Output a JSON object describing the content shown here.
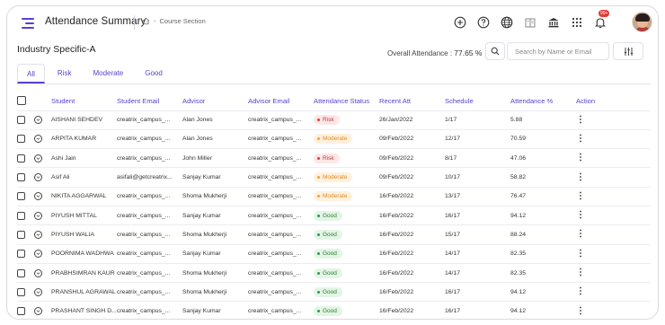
{
  "header": {
    "title": "Attendance Summary",
    "breadcrumb": "Course Section",
    "notification_count": "99+",
    "icons": [
      "add-circle-icon",
      "help-icon",
      "globe-icon",
      "book-icon",
      "institution-icon",
      "grid-icon",
      "bell-icon"
    ]
  },
  "section": {
    "title": "Industry Specific-A",
    "overall_label": "Overall Attendance : ",
    "overall_value": "77.65 %"
  },
  "search": {
    "placeholder": "Search by Name or Email"
  },
  "tabs": [
    {
      "label": "All"
    },
    {
      "label": "Risk"
    },
    {
      "label": "Moderate"
    },
    {
      "label": "Good"
    }
  ],
  "table": {
    "headers": [
      "Student",
      "Student Email",
      "Advisor",
      "Advisor Email",
      "Attendance Status",
      "Recent Att",
      "Schedule",
      "Attendance %",
      "Action"
    ],
    "rows": [
      {
        "student": "AISHANI SEHDEV",
        "email": "creatrix_campus_...",
        "advisor": "Alan Jones",
        "advisor_email": "creatrix_campus_...",
        "status": "Risk",
        "recent": "26/Jan/2022",
        "schedule": "1/17",
        "percent": "5.88"
      },
      {
        "student": "ARPITA KUMAR",
        "email": "creatrix_campus_...",
        "advisor": "Alan Jones",
        "advisor_email": "creatrix_campus_...",
        "status": "Moderate",
        "recent": "09/Feb/2022",
        "schedule": "12/17",
        "percent": "70.59"
      },
      {
        "student": "Ashi Jain",
        "email": "creatrix_campus_...",
        "advisor": "John Miller",
        "advisor_email": "creatrix_campus_...",
        "status": "Risk",
        "recent": "09/Feb/2022",
        "schedule": "8/17",
        "percent": "47.06"
      },
      {
        "student": "Asif Ali",
        "email": "asifali@getcreatrix...",
        "advisor": "Sanjay Kumar",
        "advisor_email": "creatrix_campus_...",
        "status": "Moderate",
        "recent": "09/Feb/2022",
        "schedule": "10/17",
        "percent": "58.82"
      },
      {
        "student": "NIKITA AGGARWAL",
        "email": "creatrix_campus_...",
        "advisor": "Shoma Mukherji",
        "advisor_email": "creatrix_campus_...",
        "status": "Moderate",
        "recent": "16/Feb/2022",
        "schedule": "13/17",
        "percent": "76.47"
      },
      {
        "student": "PIYUSH MITTAL",
        "email": "creatrix_campus_...",
        "advisor": "Sanjay Kumar",
        "advisor_email": "creatrix_campus_...",
        "status": "Good",
        "recent": "16/Feb/2022",
        "schedule": "16/17",
        "percent": "94.12"
      },
      {
        "student": "PIYUSH WALIA",
        "email": "creatrix_campus_...",
        "advisor": "Shoma Mukherji",
        "advisor_email": "creatrix_campus_...",
        "status": "Good",
        "recent": "16/Feb/2022",
        "schedule": "15/17",
        "percent": "88.24"
      },
      {
        "student": "POORNIMA WADHWA",
        "email": "creatrix_campus_...",
        "advisor": "Sanjay Kumar",
        "advisor_email": "creatrix_campus_...",
        "status": "Good",
        "recent": "16/Feb/2022",
        "schedule": "14/17",
        "percent": "82.35"
      },
      {
        "student": "PRABHSIMRAN KAUR",
        "email": "creatrix_campus_...",
        "advisor": "Shoma Mukherji",
        "advisor_email": "creatrix_campus_...",
        "status": "Good",
        "recent": "16/Feb/2022",
        "schedule": "14/17",
        "percent": "82.35"
      },
      {
        "student": "PRANSHUL AGRAWAL",
        "email": "creatrix_campus_...",
        "advisor": "Shoma Mukherji",
        "advisor_email": "creatrix_campus_...",
        "status": "Good",
        "recent": "16/Feb/2022",
        "schedule": "16/17",
        "percent": "94.12"
      },
      {
        "student": "PRASHANT SINGH D...",
        "email": "creatrix_campus_...",
        "advisor": "Sanjay Kumar",
        "advisor_email": "creatrix_campus_...",
        "status": "Good",
        "recent": "16/Feb/2022",
        "schedule": "16/17",
        "percent": "94.12"
      }
    ]
  },
  "colors": {
    "accent": "#5b3fd0",
    "risk": "#e53935",
    "moderate": "#f0a23a",
    "good": "#2e9b46"
  }
}
